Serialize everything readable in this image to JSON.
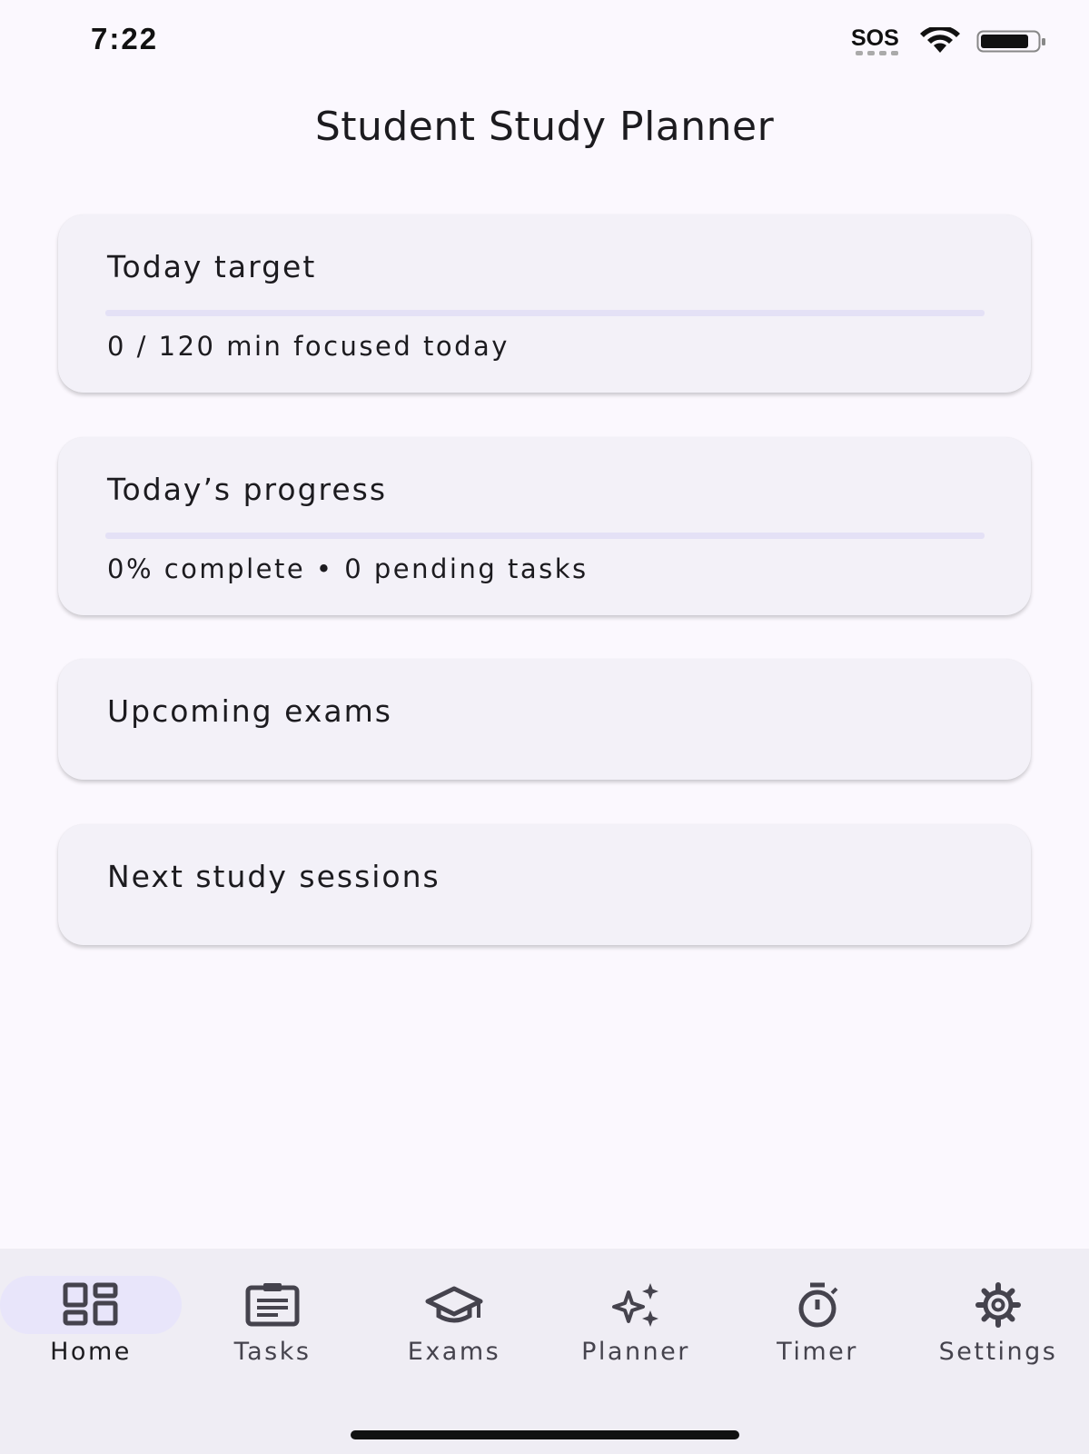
{
  "status_bar": {
    "time": "7:22",
    "carrier": "SOS",
    "wifi_icon": "wifi-icon",
    "battery_icon": "battery-icon"
  },
  "header": {
    "title": "Student Study Planner"
  },
  "cards": {
    "target": {
      "title": "Today target",
      "subtitle": "0 / 120 min focused today",
      "progress": 0
    },
    "progress": {
      "title": "Today’s progress",
      "subtitle": "0% complete • 0 pending tasks",
      "progress": 0
    },
    "exams": {
      "title": "Upcoming exams"
    },
    "sessions": {
      "title": "Next study sessions"
    }
  },
  "nav": {
    "active": "Home",
    "items": [
      {
        "label": "Home",
        "icon": "dashboard-icon"
      },
      {
        "label": "Tasks",
        "icon": "clipboard-icon"
      },
      {
        "label": "Exams",
        "icon": "graduation-cap-icon"
      },
      {
        "label": "Planner",
        "icon": "sparkles-icon"
      },
      {
        "label": "Timer",
        "icon": "stopwatch-icon"
      },
      {
        "label": "Settings",
        "icon": "gear-icon"
      }
    ]
  },
  "colors": {
    "background": "#fbf8fe",
    "card": "#f3f1f8",
    "accent": "#6750a4",
    "track": "#e4e1f6",
    "nav_background": "#efedf4",
    "active_pill": "#e8e5fa"
  }
}
